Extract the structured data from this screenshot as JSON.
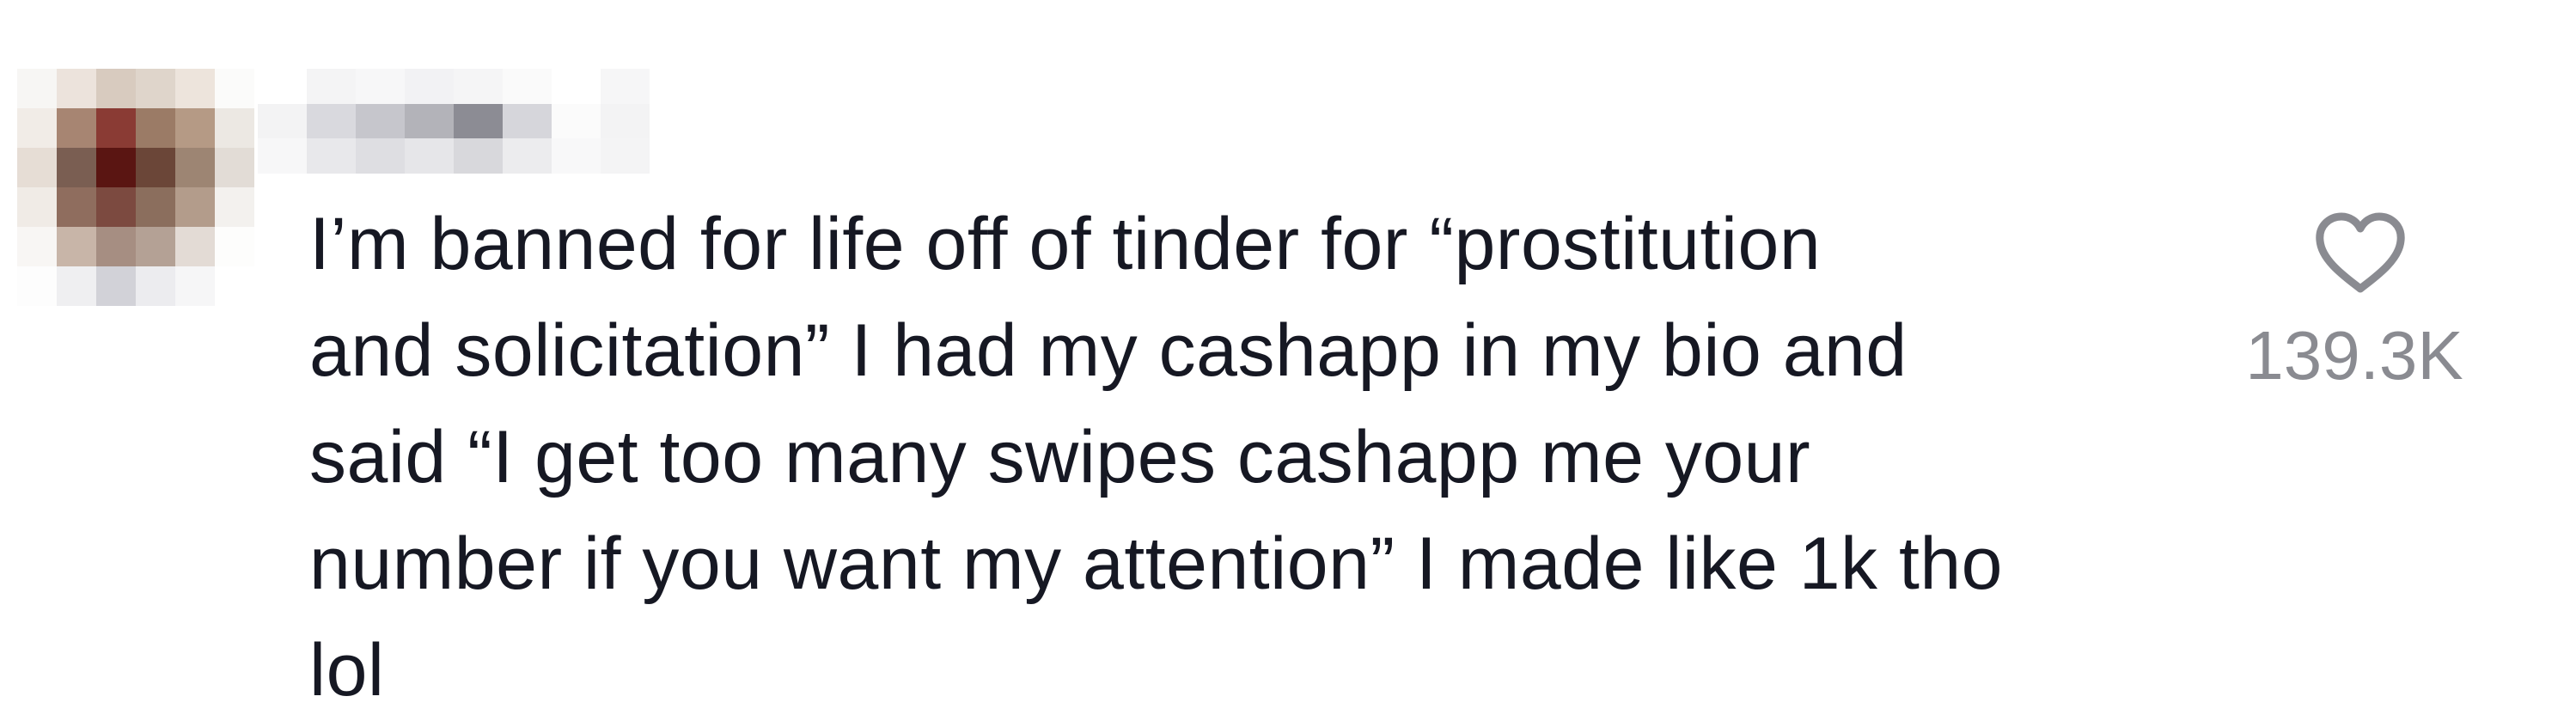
{
  "comment": {
    "text_lines": [
      "I’m banned for life off of tinder for “prostitution",
      "and solicitation” I had my cashapp in my bio and",
      "said “I get too many swipes cashapp me your",
      "number if you want my attention” I made like 1k tho",
      "lol"
    ],
    "like_count": "139.3K",
    "like_icon": "heart-outline-icon",
    "colors": {
      "text": "#161823",
      "secondary": "#8a8b91"
    }
  }
}
